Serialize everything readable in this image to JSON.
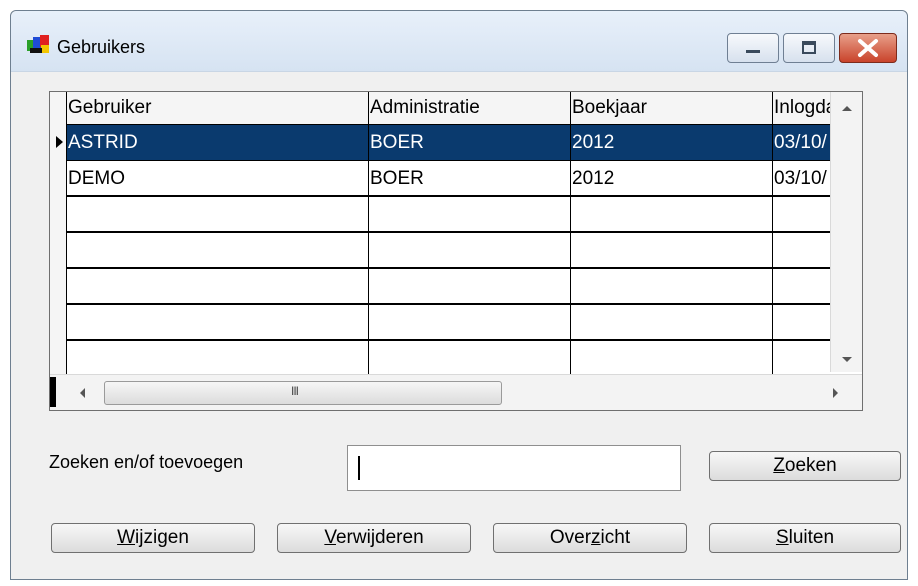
{
  "window": {
    "title": "Gebruikers"
  },
  "table": {
    "columns": [
      "Gebruiker",
      "Administratie",
      "Boekjaar",
      "Inlogda"
    ],
    "rows": [
      [
        "ASTRID",
        "BOER",
        "2012",
        "03/10/"
      ],
      [
        "DEMO",
        "BOER",
        "2012",
        "03/10/"
      ]
    ],
    "empty_rows": 5,
    "selected_row": 0
  },
  "search": {
    "label": "Zoeken en/of toevoegen",
    "value": "",
    "button_accel": "Z",
    "button_rest": "oeken"
  },
  "buttons": {
    "wijzigen": {
      "accel": "W",
      "rest": "ijzigen"
    },
    "verwijderen": {
      "accel": "V",
      "rest": "erwijderen"
    },
    "overzicht": {
      "prefix": "Over",
      "accel": "z",
      "rest": "icht"
    },
    "sluiten": {
      "accel": "S",
      "rest": "luiten"
    }
  },
  "scrollbar": {
    "grip_label": "III"
  }
}
